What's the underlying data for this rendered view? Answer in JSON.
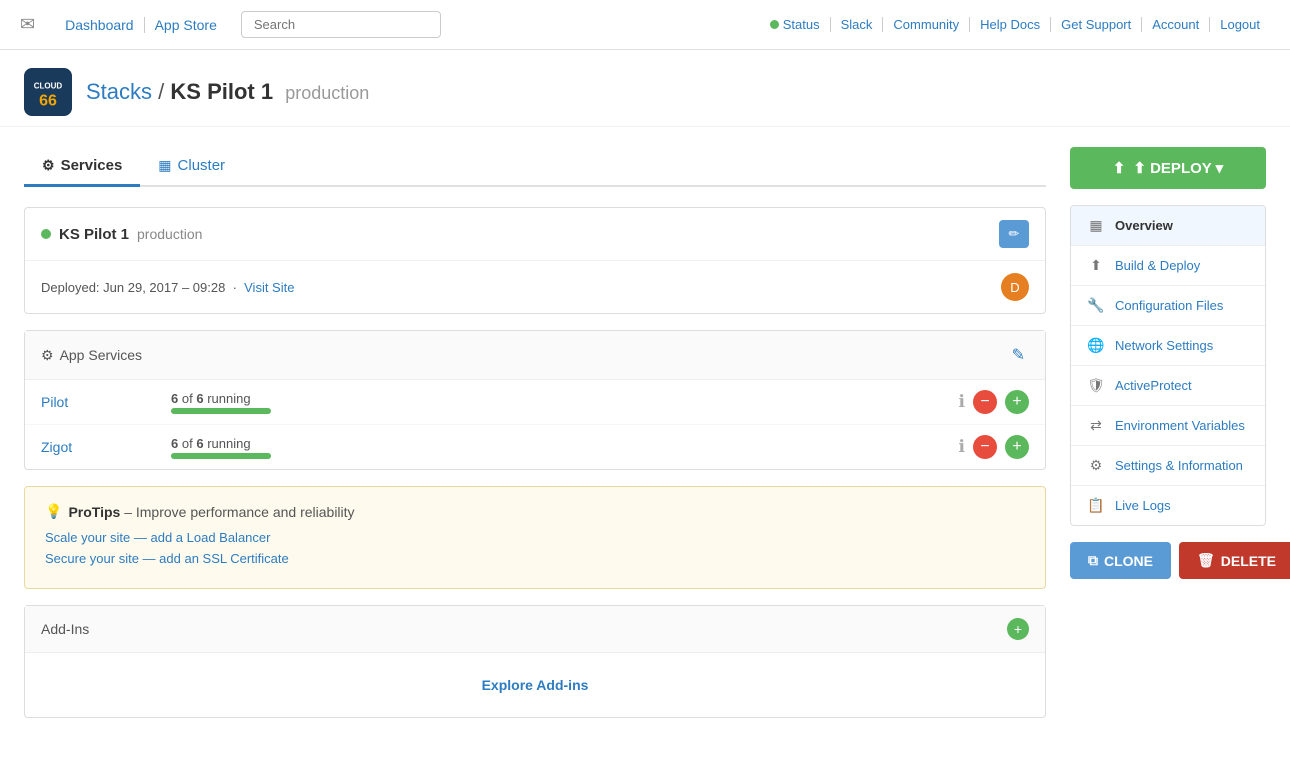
{
  "nav": {
    "mail_icon": "✉",
    "links": [
      {
        "label": "Dashboard",
        "href": "#"
      },
      {
        "label": "App Store",
        "href": "#"
      }
    ],
    "search_placeholder": "Search",
    "right_links": [
      {
        "label": "Status",
        "is_status": true
      },
      {
        "label": "Slack",
        "href": "#"
      },
      {
        "label": "Community",
        "href": "#"
      },
      {
        "label": "Help Docs",
        "href": "#"
      },
      {
        "label": "Get Support",
        "href": "#"
      },
      {
        "label": "Account",
        "href": "#"
      },
      {
        "label": "Logout",
        "href": "#"
      }
    ]
  },
  "breadcrumb": {
    "stacks_label": "Stacks",
    "separator": "/",
    "stack_name": "KS Pilot 1",
    "env": "production"
  },
  "tabs": [
    {
      "label": "Services",
      "icon": "⚙",
      "active": true
    },
    {
      "label": "Cluster",
      "icon": "▦",
      "active": false
    }
  ],
  "stack_status": {
    "title": "KS Pilot 1",
    "env": "production",
    "deployed_label": "Deployed:",
    "deployed_date": "Jun 29, 2017 – 09:28",
    "visit_site_label": "Visit Site"
  },
  "app_services": {
    "title": "App Services",
    "services": [
      {
        "name": "Pilot",
        "running_count": "6",
        "total_count": "6",
        "running_label": "running",
        "progress": 100
      },
      {
        "name": "Zigot",
        "running_count": "6",
        "total_count": "6",
        "running_label": "running",
        "progress": 100
      }
    ]
  },
  "protips": {
    "icon": "💡",
    "title": "ProTips",
    "subtitle": "– Improve performance and reliability",
    "links": [
      {
        "label": "Scale your site — add a Load Balancer"
      },
      {
        "label": "Secure your site — add an SSL Certificate"
      }
    ]
  },
  "addins": {
    "title": "Add-Ins",
    "explore_label": "Explore Add-ins"
  },
  "sidebar": {
    "deploy_label": "⬆ DEPLOY ▾",
    "nav_items": [
      {
        "icon": "▦",
        "label": "Overview",
        "active": true
      },
      {
        "icon": "⬆",
        "label": "Build & Deploy"
      },
      {
        "icon": "🔧",
        "label": "Configuration Files"
      },
      {
        "icon": "🌐",
        "label": "Network Settings"
      },
      {
        "icon": "🛡",
        "label": "ActiveProtect"
      },
      {
        "icon": "⇄",
        "label": "Environment Variables"
      },
      {
        "icon": "⚙",
        "label": "Settings & Information"
      },
      {
        "icon": "📋",
        "label": "Live Logs"
      }
    ],
    "clone_label": "CLONE",
    "delete_label": "DELETE"
  }
}
